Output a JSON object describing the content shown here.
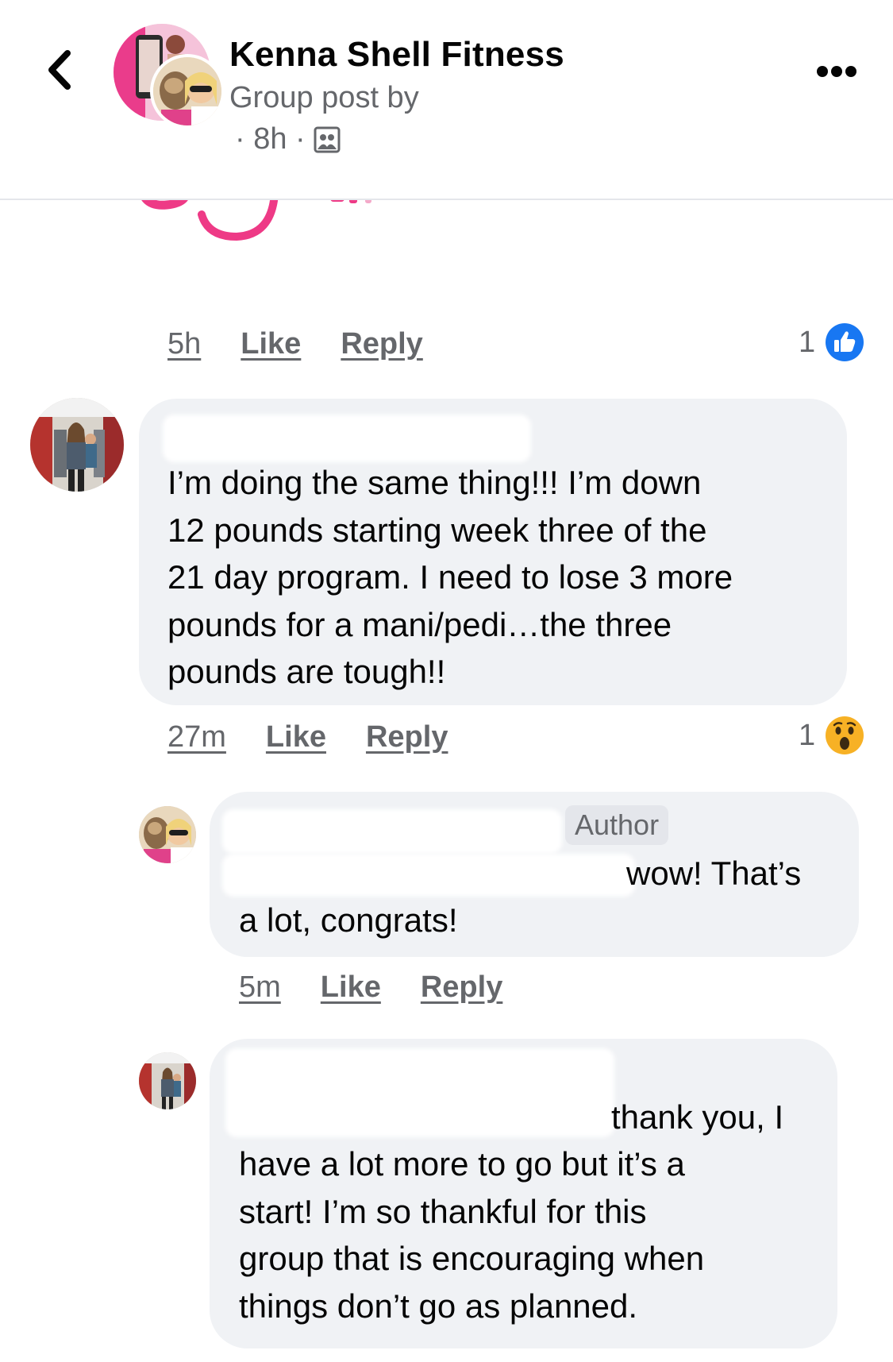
{
  "header": {
    "group_name": "Kenna Shell Fitness",
    "post_by": "Group post by",
    "time": "· 8h ·",
    "privacy_icon": "members-icon",
    "back_icon": "chevron-left-icon",
    "more_icon": "more-horizontal-icon"
  },
  "comments": [
    {
      "time": "5h",
      "like": "Like",
      "reply": "Reply",
      "reaction_count": "1",
      "reaction_icon": "thumbs-up-icon"
    },
    {
      "text_lines": [
        "I’m doing the same thing!!! I’m down",
        "12 pounds starting week three of the",
        "21 day program. I need to lose 3 more",
        "pounds for a mani/pedi…the three",
        "pounds are tough!!"
      ],
      "time": "27m",
      "like": "Like",
      "reply": "Reply",
      "reaction_count": "1",
      "reaction_icon": "wow-icon"
    },
    {
      "badge": "Author",
      "text_end": "wow! That’s",
      "text_line2": "a lot, congrats!",
      "time": "5m",
      "like": "Like",
      "reply": "Reply"
    },
    {
      "text_end": "thank you, I",
      "text_lines": [
        "have a lot more to go but it’s a",
        "start!  I’m so thankful for this",
        "group that is encouraging when",
        "things don’t go as planned."
      ]
    }
  ],
  "colors": {
    "accent_blue": "#1877f2",
    "bubble_gray": "#f0f2f5",
    "meta_gray": "#65676b",
    "sticker_pink": "#ee3a86"
  }
}
